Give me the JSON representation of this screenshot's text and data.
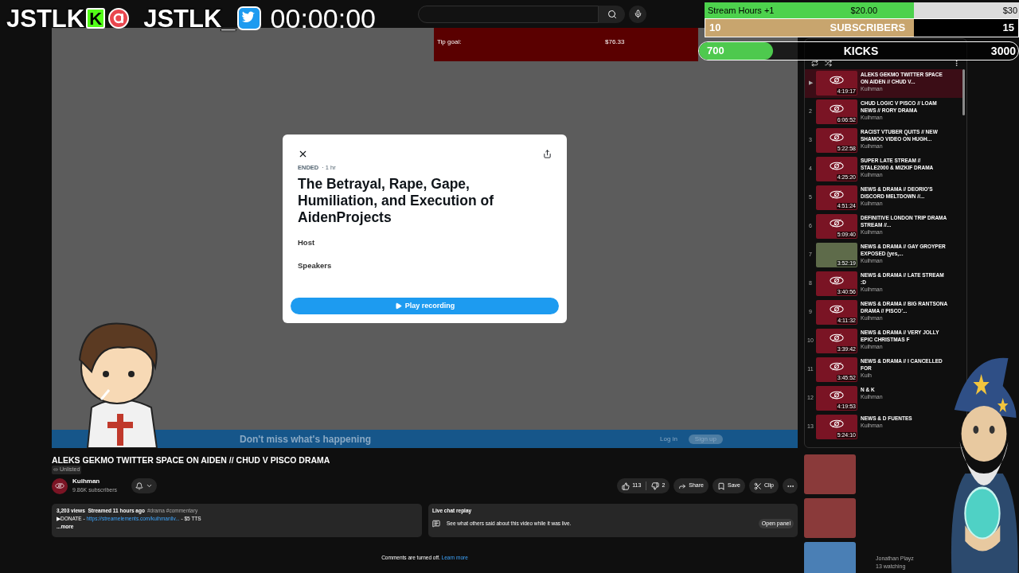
{
  "overlay": {
    "logo_text": "JSTLK",
    "kick_letter": "K",
    "handle": "JSTLK_",
    "timer": "00:00:00",
    "tip_goal": {
      "label": "Tip goal:",
      "amount": "$76.33"
    },
    "stream_hours": {
      "label": "Stream Hours +1",
      "amount": "$20.00",
      "target": "$30",
      "level": 0.667
    },
    "subscribers": {
      "count": "10",
      "label": "SUBSCRIBERS",
      "target": "15",
      "level": 0.667
    },
    "kicks": {
      "count": "700",
      "label": "KICKS",
      "target": "3000",
      "level": 0.233
    }
  },
  "twitter_space": {
    "status": "ENDED",
    "age": "· 1 hr",
    "title": "The Betrayal, Rape, Gape, Humiliation, and Execution of AidenProjects",
    "sections": [
      "Host",
      "Speakers"
    ],
    "button": "Play recording"
  },
  "signup_banner": {
    "text": "Don't miss what's happening",
    "login": "Log in",
    "signup": "Sign up"
  },
  "video": {
    "title": "ALEKS GEKMO TWITTER SPACE ON AIDEN // CHUD V PISCO DRAMA",
    "visibility": "Unlisted",
    "channel": {
      "name": "Kuihman",
      "subscribers": "9.86K subscribers"
    },
    "likes": "113",
    "dislikes": "2",
    "actions": [
      {
        "kind": "share",
        "label": "Share"
      },
      {
        "kind": "save",
        "label": "Save"
      },
      {
        "kind": "clip",
        "label": "Clip"
      }
    ],
    "description": {
      "stats": "3,203 views  Streamed 11 hours ago",
      "tags": "#drama #commentary",
      "donate_prefix": "▶DONATE - ",
      "link": "https://streamelements.com/kuihmanliv...",
      "donate_suffix": " - $5 TTS",
      "more": "...more"
    }
  },
  "live_chat": {
    "title": "Live chat replay",
    "text": "See what others said about this video while it was live.",
    "button": "Open panel"
  },
  "comments": {
    "text": "Comments are turned off.",
    "link": "Learn more"
  },
  "playlist": {
    "items": [
      {
        "marker": "▶",
        "title": "ALEKS GEKMO TWITTER SPACE ON AIDEN // CHUD V...",
        "duration": "4:19:17",
        "channel": "Kuihman",
        "kind": "logo",
        "selected": true
      },
      {
        "marker": "2",
        "title": "CHUD LOGIC V PISCO // LOAM NEWS // RORY DRAMA",
        "duration": "6:06:52",
        "channel": "Kuihman",
        "kind": "logo",
        "selected": false
      },
      {
        "marker": "3",
        "title": "RACIST VTUBER QUITS // NEW SHAMOO VIDEO ON HUGH...",
        "duration": "5:22:58",
        "channel": "Kuihman",
        "kind": "logo",
        "selected": false
      },
      {
        "marker": "4",
        "title": "SUPER LATE STREAM // STALE2000 & MIZKIF DRAMA",
        "duration": "4:25:20",
        "channel": "Kuihman",
        "kind": "logo",
        "selected": false
      },
      {
        "marker": "5",
        "title": "NEWS & DRAMA // DEORIO'S DISCORD MELTDOWN //...",
        "duration": "4:51:24",
        "channel": "Kuihman",
        "kind": "logo",
        "selected": false
      },
      {
        "marker": "6",
        "title": "DEFINITIVE LONDON TRIP DRAMA STREAM //...",
        "duration": "5:09:40",
        "channel": "Kuihman",
        "kind": "logo",
        "selected": false
      },
      {
        "marker": "7",
        "title": "NEWS & DRAMA // GAY GROYPER EXPOSED (yes,...",
        "duration": "3:52:19",
        "channel": "Kuihman",
        "kind": "photo",
        "selected": false
      },
      {
        "marker": "8",
        "title": "NEWS & DRAMA // LATE STREAM :D",
        "duration": "3:40:56",
        "channel": "Kuihman",
        "kind": "logo",
        "selected": false
      },
      {
        "marker": "9",
        "title": "NEWS & DRAMA // BIG RANTSONA DRAMA // PISCO'...",
        "duration": "4:11:32",
        "channel": "Kuihman",
        "kind": "logo",
        "selected": false
      },
      {
        "marker": "10",
        "title": "NEWS & DRAMA // VERY JOLLY EPIC CHRISTMAS F",
        "duration": "3:39:42",
        "channel": "Kuihman",
        "kind": "logo",
        "selected": false
      },
      {
        "marker": "11",
        "title": "NEWS & DRAMA // I CANCELLED FOR",
        "duration": "3:45:52",
        "channel": "Kuih",
        "kind": "logo",
        "selected": false
      },
      {
        "marker": "12",
        "title": "N & K",
        "duration": "4:19:53",
        "channel": "Kuihman",
        "kind": "logo",
        "selected": false
      },
      {
        "marker": "13",
        "title": "NEWS & D FUENTES",
        "duration": "5:24:10",
        "channel": "Kuihman",
        "kind": "logo",
        "selected": false
      }
    ]
  },
  "recommended": [
    {
      "kind": "thumbnail"
    },
    {
      "kind": "thumbnail"
    },
    {
      "kind": "live",
      "channel": "Jonathan Playz",
      "viewers": "13 watching"
    }
  ]
}
